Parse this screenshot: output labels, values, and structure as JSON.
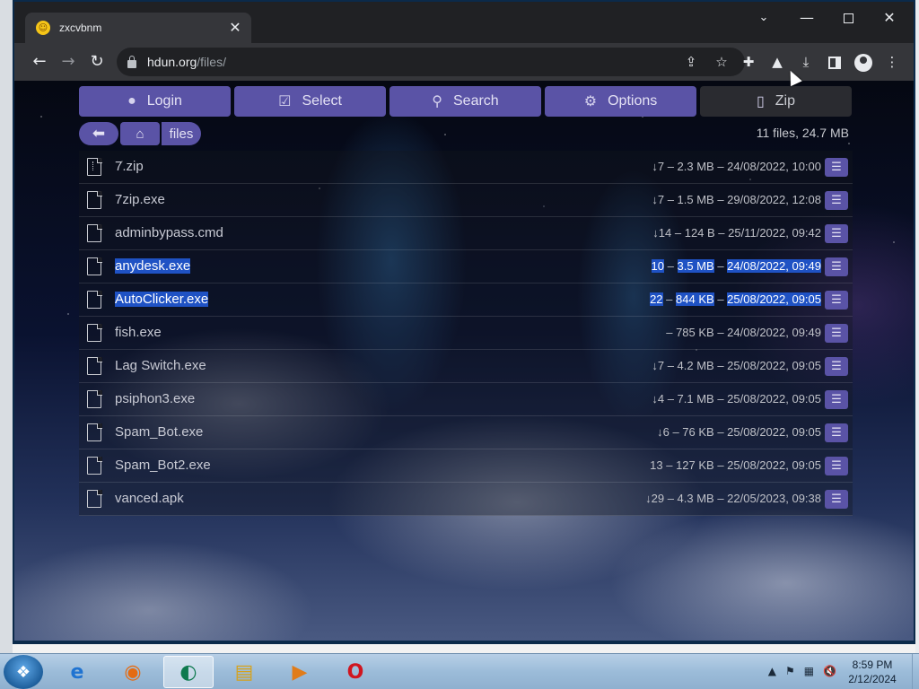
{
  "browser": {
    "tab_title": "zxcvbnm",
    "tab_close": "✕",
    "url_host": "hdun.org",
    "url_path": "/files/"
  },
  "toolbar_buttons": {
    "login": "Login",
    "select": "Select",
    "search": "Search",
    "options": "Options",
    "zip": "Zip"
  },
  "breadcrumb": {
    "current": "files"
  },
  "summary": "11 files, 24.7 MB",
  "files": [
    {
      "name": "7.zip",
      "meta": "↓7 – 2.3 MB – 24/08/2022, 10:00",
      "type": "zip"
    },
    {
      "name": "7zip.exe",
      "meta": "↓7 – 1.5 MB – 29/08/2022, 12:08",
      "type": "file"
    },
    {
      "name": "adminbypass.cmd",
      "meta": "↓14 – 124 B – 25/11/2022, 09:42",
      "type": "file"
    },
    {
      "name": "anydesk.exe",
      "downloads": "10",
      "size": "3.5 MB",
      "date": "24/08/2022, 09:49",
      "type": "file",
      "selected": true
    },
    {
      "name": "AutoClicker.exe",
      "downloads": "22",
      "size": "844 KB",
      "date": "25/08/2022, 09:05",
      "type": "file",
      "selected": true
    },
    {
      "name": "fish.exe",
      "meta": "– 785 KB – 24/08/2022, 09:49",
      "type": "file"
    },
    {
      "name": "Lag Switch.exe",
      "meta": "↓7 – 4.2 MB – 25/08/2022, 09:05",
      "type": "file"
    },
    {
      "name": "psiphon3.exe",
      "meta": "↓4 – 7.1 MB – 25/08/2022, 09:05",
      "type": "file"
    },
    {
      "name": "Spam_Bot.exe",
      "meta": "↓6 – 76 KB – 25/08/2022, 09:05",
      "type": "file"
    },
    {
      "name": "Spam_Bot2.exe",
      "meta": "13 – 127 KB – 25/08/2022, 09:05",
      "type": "file"
    },
    {
      "name": "vanced.apk",
      "meta": "↓29 – 4.3 MB – 22/05/2023, 09:38",
      "type": "file"
    }
  ],
  "meta_separator": "–",
  "taskbar": {
    "time": "8:59 PM",
    "date": "2/12/2024"
  },
  "icons": {
    "tab_favicon": "smiley-icon",
    "back": "arrow-left-icon",
    "forward": "arrow-right-icon",
    "reload": "reload-icon",
    "lock": "lock-icon",
    "share": "share-icon",
    "star": "star-icon",
    "extensions": "puzzle-icon",
    "labs": "flask-icon",
    "download": "download-icon",
    "sidepanel": "side-panel-icon",
    "profile": "profile-icon",
    "menu": "kebab-menu-icon",
    "login": "user-icon",
    "select": "checkbox-icon",
    "search": "search-icon",
    "options": "gear-icon",
    "zip": "zip-file-icon",
    "file": "file-icon",
    "row_menu": "hamburger-icon"
  },
  "colors": {
    "accent": "#5a53a6",
    "selection": "#1f52c4",
    "browser_dark": "#202124",
    "browser_toolbar": "#35363a"
  }
}
